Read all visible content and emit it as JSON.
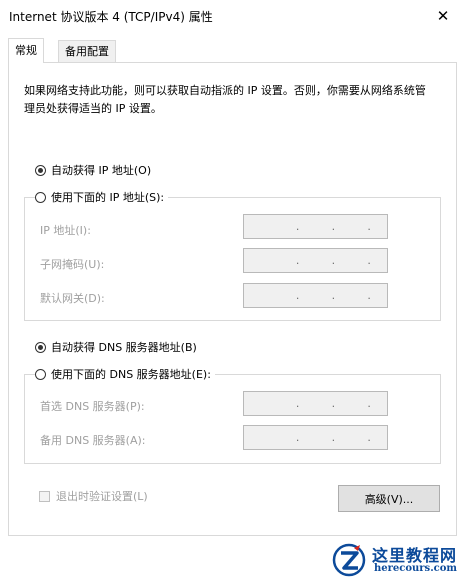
{
  "window": {
    "title": "Internet 协议版本 4 (TCP/IPv4) 属性",
    "close_symbol": "✕"
  },
  "tabs": [
    {
      "label": "常规",
      "active": true
    },
    {
      "label": "备用配置",
      "active": false
    }
  ],
  "description": "如果网络支持此功能，则可以获取自动指派的 IP 设置。否则，你需要从网络系统管理员处获得适当的 IP 设置。",
  "ip_section": {
    "auto_label": "自动获得 IP 地址(O)",
    "manual_label": "使用下面的 IP 地址(S):",
    "selected": "auto",
    "fields": [
      {
        "label": "IP 地址(I):",
        "value": ".  .  ."
      },
      {
        "label": "子网掩码(U):",
        "value": ".  .  ."
      },
      {
        "label": "默认网关(D):",
        "value": ".  .  ."
      }
    ]
  },
  "dns_section": {
    "auto_label": "自动获得 DNS 服务器地址(B)",
    "manual_label": "使用下面的 DNS 服务器地址(E):",
    "selected": "auto",
    "fields": [
      {
        "label": "首选 DNS 服务器(P):",
        "value": ".  .  ."
      },
      {
        "label": "备用 DNS 服务器(A):",
        "value": ".  .  ."
      }
    ]
  },
  "validate_checkbox": {
    "label": "退出时验证设置(L)",
    "checked": false,
    "enabled": false
  },
  "advanced_button": {
    "label": "高级(V)..."
  },
  "watermark": {
    "title": "这里教程网",
    "url": "herecours.com"
  },
  "colors": {
    "disabled_text": "#a0a0a0",
    "group_border": "#d9d9d9",
    "watermark_blue": "#0c4a9a"
  }
}
